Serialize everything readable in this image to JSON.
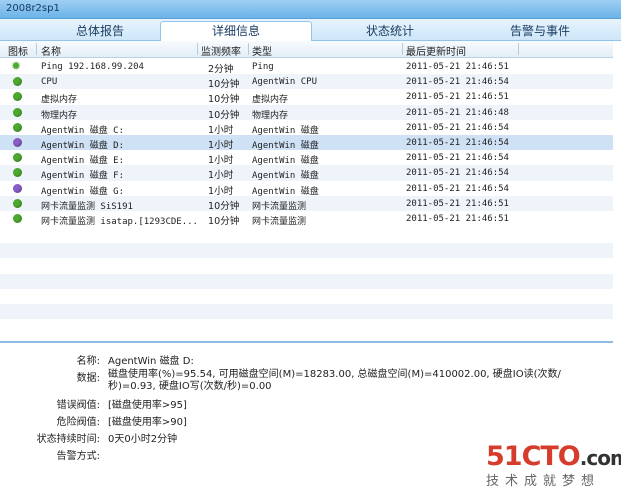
{
  "window": {
    "title": "2008r2sp1"
  },
  "tabs": [
    {
      "label": "总体报告",
      "active": false
    },
    {
      "label": "详细信息",
      "active": true
    },
    {
      "label": "状态统计",
      "active": false
    },
    {
      "label": "告警与事件",
      "active": false
    }
  ],
  "table": {
    "columns": [
      "图标",
      "名称",
      "监测频率",
      "类型",
      "最后更新时间"
    ],
    "rows": [
      {
        "icon": "gear-green",
        "name": "Ping 192.168.99.204",
        "freq": "2分钟",
        "type": "Ping",
        "time": "2011-05-21 21:46:51"
      },
      {
        "icon": "dot-green",
        "name": "CPU",
        "freq": "10分钟",
        "type": "AgentWin CPU",
        "time": "2011-05-21 21:46:54"
      },
      {
        "icon": "dot-green",
        "name": "虚拟内存",
        "freq": "10分钟",
        "type": "虚拟内存",
        "time": "2011-05-21 21:46:51"
      },
      {
        "icon": "dot-green",
        "name": "物理内存",
        "freq": "10分钟",
        "type": "物理内存",
        "time": "2011-05-21 21:46:48"
      },
      {
        "icon": "dot-green",
        "name": "AgentWin 磁盘 C:",
        "freq": "1小时",
        "type": "AgentWin 磁盘",
        "time": "2011-05-21 21:46:54"
      },
      {
        "icon": "dot-purple",
        "name": "AgentWin 磁盘 D:",
        "freq": "1小时",
        "type": "AgentWin 磁盘",
        "time": "2011-05-21 21:46:54",
        "selected": true
      },
      {
        "icon": "dot-green",
        "name": "AgentWin 磁盘 E:",
        "freq": "1小时",
        "type": "AgentWin 磁盘",
        "time": "2011-05-21 21:46:54"
      },
      {
        "icon": "dot-green",
        "name": "AgentWin 磁盘 F:",
        "freq": "1小时",
        "type": "AgentWin 磁盘",
        "time": "2011-05-21 21:46:54"
      },
      {
        "icon": "dot-purple",
        "name": "AgentWin 磁盘 G:",
        "freq": "1小时",
        "type": "AgentWin 磁盘",
        "time": "2011-05-21 21:46:54"
      },
      {
        "icon": "dot-green",
        "name": "网卡流量监测 SiS191",
        "freq": "10分钟",
        "type": "网卡流量监测",
        "time": "2011-05-21 21:46:51"
      },
      {
        "icon": "dot-green",
        "name": "网卡流量监测 isatap.[1293CDE...",
        "freq": "10分钟",
        "type": "网卡流量监测",
        "time": "2011-05-21 21:46:51"
      }
    ]
  },
  "detail": {
    "name_label": "名称:",
    "name_value": "AgentWin 磁盘 D:",
    "data_label": "数据:",
    "data_value": "磁盘使用率(%)=95.54, 可用磁盘空间(M)=18283.00, 总磁盘空间(M)=410002.00, 硬盘IO读(次数/秒)=0.93, 硬盘IO写(次数/秒)=0.00",
    "error_label": "错误阀值:",
    "error_value": "[磁盘使用率>95]",
    "warn_label": "危险阀值:",
    "warn_value": "[磁盘使用率>90]",
    "duration_label": "状态持续时间:",
    "duration_value": "0天0小时2分钟",
    "alert_label": "告警方式:",
    "alert_value": ""
  },
  "watermark": {
    "logo": "51CTO",
    "suffix": ".com",
    "slogan": "技术成就梦想"
  },
  "colors": {
    "green": "#4caa2f",
    "purple": "#8a5cc8",
    "selected": "#cfe1f5"
  }
}
